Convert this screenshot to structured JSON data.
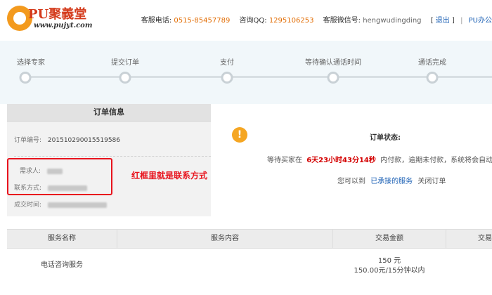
{
  "header": {
    "logo_title": "PU聚義堂",
    "logo_url": "www.pujyt.com",
    "phone_label": "客服电话:",
    "phone_value": "0515-85457789",
    "qq_label": "咨询QQ:",
    "qq_value": "1295106253",
    "wechat_label": "客服微信号:",
    "wechat_value": "hengwudingding",
    "bracket_open": "[",
    "logout_label": "退出",
    "bracket_close": "]",
    "pipe": "|",
    "office_link": "PU办公"
  },
  "progress": {
    "steps": [
      {
        "label": "选择专家"
      },
      {
        "label": "提交订单"
      },
      {
        "label": "支付"
      },
      {
        "label": "等待确认通话时间"
      },
      {
        "label": "通话完成"
      }
    ]
  },
  "order": {
    "heading": "订单信息",
    "order_no_label": "订单编号:",
    "order_no_value": "201510290015519586",
    "requester_label": "需求人:",
    "contact_label": "联系方式:",
    "deal_time_label": "成交时间:",
    "annotation": "红框里就是联系方式"
  },
  "status": {
    "title": "订单状态:",
    "line_prefix": "等待买家在",
    "countdown": "6天23小时43分14秒",
    "line_suffix": "内付款，逾期未付款，系统将会自动关闭",
    "line2_prefix": "您可以到",
    "line2_link": "已承接的服务",
    "line2_suffix": "关闭订单"
  },
  "table": {
    "headers": [
      "服务名称",
      "服务内容",
      "交易金额",
      "交易"
    ],
    "row": {
      "name": "电话咨询服务",
      "amount": "150 元",
      "rate": "150.00元/15分钟以内"
    }
  },
  "colors": {
    "accent_red": "#e8131d",
    "link_blue": "#1a5fb4",
    "orange": "#e26b00"
  }
}
